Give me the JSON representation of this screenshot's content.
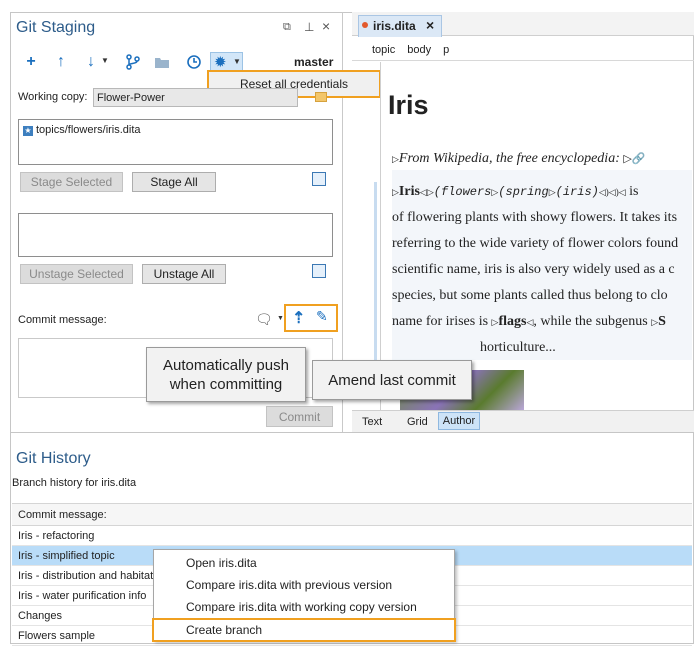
{
  "staging": {
    "title": "Git Staging",
    "branch": "master",
    "working_copy_label": "Working copy:",
    "working_copy_value": "Flower-Power",
    "unstaged_file": "topics/flowers/iris.dita",
    "stage_selected": "Stage Selected",
    "stage_all": "Stage All",
    "unstage_selected": "Unstage Selected",
    "unstage_all": "Unstage All",
    "commit_message_label": "Commit message:",
    "commit_button": "Commit",
    "settings_menu_item": "Reset all credentials",
    "tooltip_push": "Automatically push when committing",
    "tooltip_amend": "Amend last commit"
  },
  "editor": {
    "tab_label": "iris.dita",
    "breadcrumb": [
      "topic",
      "body",
      "p"
    ],
    "heading": "Iris",
    "shortdesc": "From Wikipedia, the free encyclopedia:",
    "para_lines": [
      "Iris",
      "(flowers",
      "(spring",
      "(iris)",
      "is",
      "of flowering plants with showy flowers. It takes its",
      "referring to the wide variety of flower colors found",
      "scientific name, iris is also very widely used as a c",
      "species, but some plants called thus belong to clo",
      "name for irises is",
      "flags",
      ", while the subgenus",
      "S",
      "horticulture..."
    ],
    "mode_tabs": [
      "Text",
      "Grid",
      "Author"
    ],
    "active_mode": "Author"
  },
  "history": {
    "title": "Git History",
    "subtitle": "Branch history for iris.dita",
    "column_header": "Commit message:",
    "rows": [
      "Iris - refactoring",
      "Iris - simplified topic",
      "Iris - distribution and habitat",
      "Iris - water purification info",
      "Changes",
      "Flowers sample"
    ],
    "selected_index": 1
  },
  "context_menu": {
    "items": [
      "Open iris.dita",
      "Compare iris.dita with previous version",
      "Compare iris.dita with working copy version",
      "Create branch"
    ]
  },
  "colors": {
    "accent": "#1b6fbe",
    "highlight": "#f0a020",
    "selection": "#b9dcf8"
  }
}
